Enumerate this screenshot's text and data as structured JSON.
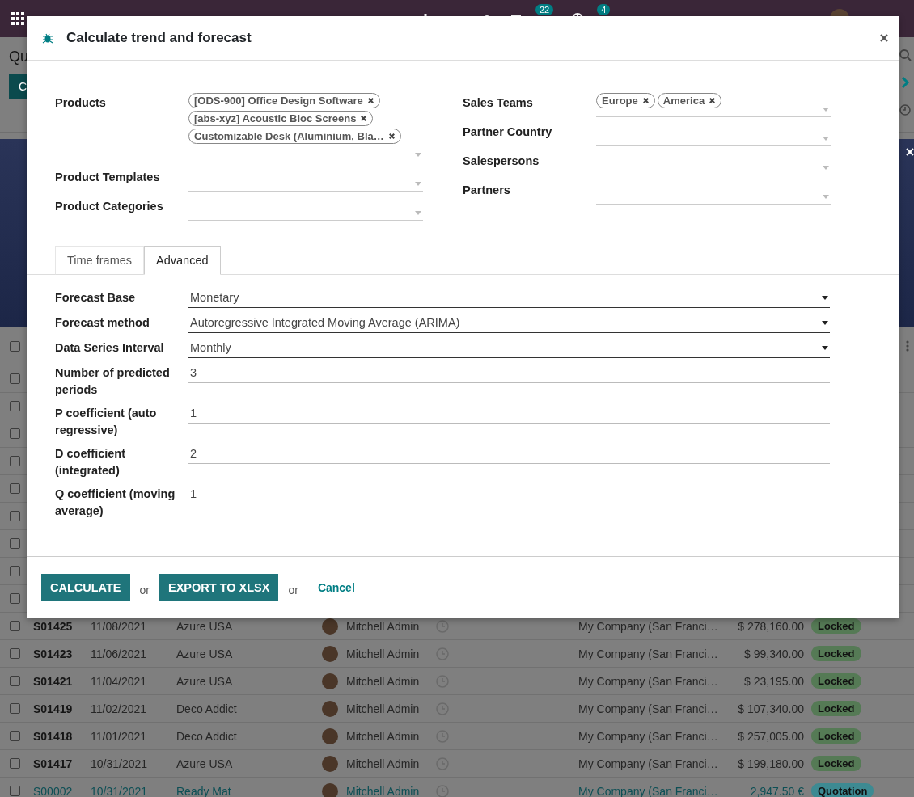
{
  "navbar": {
    "badges": [
      {
        "kind": "chat",
        "count": "22"
      },
      {
        "kind": "activity",
        "count": "4"
      }
    ]
  },
  "page": {
    "title": "Qu",
    "create_button": "C"
  },
  "table": {
    "header_checked": false,
    "covered_rows": [
      {
        "checked": false
      },
      {
        "checked": false
      },
      {
        "checked": false
      },
      {
        "checked": false
      },
      {
        "checked": false
      },
      {
        "checked": false
      },
      {
        "checked": false
      },
      {
        "checked": false
      },
      {
        "checked": false
      }
    ],
    "rows": [
      {
        "checked": false,
        "highlighted": false,
        "number": "S01425",
        "date": "11/08/2021",
        "customer": "Azure USA",
        "salesperson": "Mitchell Admin",
        "company": "My Company (San Franci…",
        "total": "$ 278,160.00",
        "status": "Locked",
        "color": "#557a55"
      },
      {
        "checked": false,
        "highlighted": false,
        "number": "S01423",
        "date": "11/06/2021",
        "customer": "Azure USA",
        "salesperson": "Mitchell Admin",
        "company": "My Company (San Franci…",
        "total": "$ 99,340.00",
        "status": "Locked",
        "color": "#557a55"
      },
      {
        "checked": false,
        "highlighted": false,
        "number": "S01421",
        "date": "11/04/2021",
        "customer": "Azure USA",
        "salesperson": "Mitchell Admin",
        "company": "My Company (San Franci…",
        "total": "$ 23,195.00",
        "status": "Locked",
        "color": "#557a55"
      },
      {
        "checked": false,
        "highlighted": false,
        "number": "S01419",
        "date": "11/02/2021",
        "customer": "Deco Addict",
        "salesperson": "Mitchell Admin",
        "company": "My Company (San Franci…",
        "total": "$ 107,340.00",
        "status": "Locked",
        "color": "#557a55"
      },
      {
        "checked": false,
        "highlighted": false,
        "number": "S01418",
        "date": "11/01/2021",
        "customer": "Deco Addict",
        "salesperson": "Mitchell Admin",
        "company": "My Company (San Franci…",
        "total": "$ 257,005.00",
        "status": "Locked",
        "color": "#557a55"
      },
      {
        "checked": false,
        "highlighted": false,
        "number": "S01417",
        "date": "10/31/2021",
        "customer": "Azure USA",
        "salesperson": "Mitchell Admin",
        "company": "My Company (San Franci…",
        "total": "$ 199,180.00",
        "status": "Locked",
        "color": "#557a55"
      },
      {
        "checked": false,
        "highlighted": true,
        "number": "S00002",
        "date": "10/31/2021",
        "customer": "Ready Mat",
        "salesperson": "Mitchell Admin",
        "company": "My Company (San Franci…",
        "total": "2,947.50 €",
        "status": "Quotation",
        "color": "#3d8a92"
      }
    ]
  },
  "dialog": {
    "title": "Calculate trend and forecast",
    "left_fields": [
      {
        "label": "Products",
        "tags": [
          "[ODS-900] Office Design Software",
          "[abs-xyz] Acoustic Bloc Screens",
          "Customizable Desk (Aluminium, Bla…"
        ]
      },
      {
        "label": "Product Templates"
      },
      {
        "label": "Product Categories"
      }
    ],
    "right_fields": [
      {
        "label": "Sales Teams",
        "tags": [
          "Europe",
          "America"
        ]
      },
      {
        "label": "Partner Country"
      },
      {
        "label": "Salespersons"
      },
      {
        "label": "Partners"
      }
    ],
    "tabs": [
      {
        "label": "Time frames",
        "selected": false
      },
      {
        "label": "Advanced",
        "selected": true
      }
    ],
    "advanced_fields": [
      {
        "label": "Forecast Base",
        "kind": "select",
        "value": "Monetary"
      },
      {
        "label": "Forecast method",
        "kind": "select",
        "value": "Autoregressive Integrated Moving Average (ARIMA)"
      },
      {
        "label": "Data Series Interval",
        "kind": "select",
        "value": "Monthly"
      },
      {
        "label": "Number of predicted periods",
        "kind": "number",
        "value": "3"
      },
      {
        "label": "P coefficient (auto regressive)",
        "kind": "number",
        "value": "1"
      },
      {
        "label": "D coefficient (integrated)",
        "kind": "number",
        "value": "2"
      },
      {
        "label": "Q coefficient (moving average)",
        "kind": "number",
        "value": "1"
      }
    ],
    "footer": [
      {
        "kind": "primary",
        "label": "CALCULATE"
      },
      {
        "kind": "text",
        "label": "or"
      },
      {
        "kind": "primary",
        "label": "EXPORT TO XLSX"
      },
      {
        "kind": "text",
        "label": "or"
      },
      {
        "kind": "link",
        "label": "Cancel"
      }
    ]
  }
}
